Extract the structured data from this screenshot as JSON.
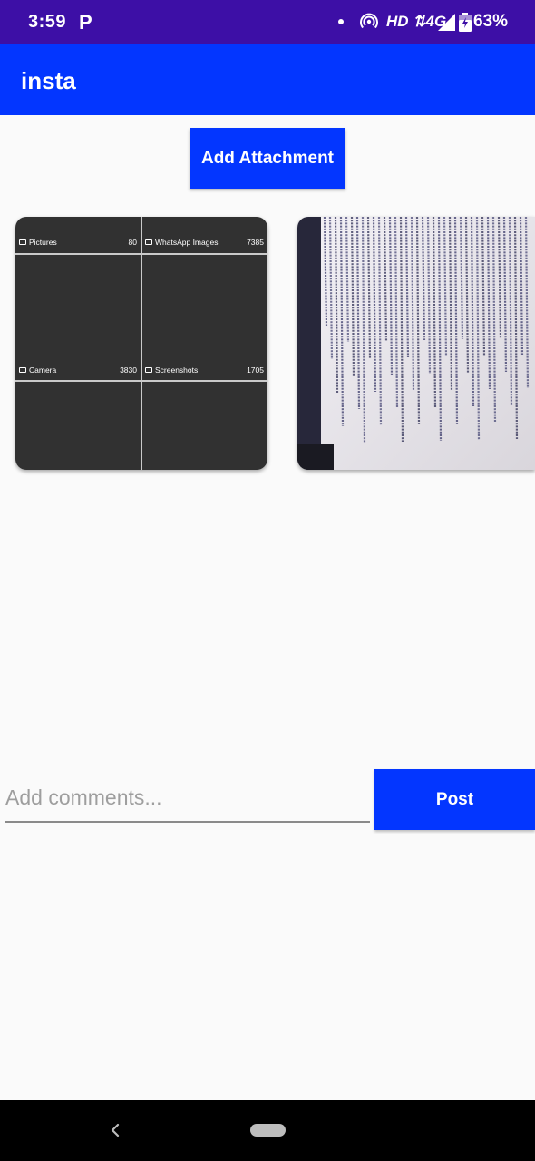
{
  "status_bar": {
    "time": "3:59",
    "notification_icon": "P",
    "network": "HD ⇅4G",
    "battery": "63%",
    "icons": [
      "notification-dot-icon",
      "hotspot-icon",
      "signal-icon",
      "battery-icon"
    ]
  },
  "app_bar": {
    "title": "insta"
  },
  "attach_button": {
    "label": "Add Attachment"
  },
  "gallery": {
    "folders": [
      {
        "name": "Pictures",
        "count": "80"
      },
      {
        "name": "WhatsApp Images",
        "count": "7385"
      },
      {
        "name": "Camera",
        "count": "3830"
      },
      {
        "name": "Screenshots",
        "count": "1705"
      }
    ]
  },
  "comment": {
    "placeholder": "Add comments...",
    "value": ""
  },
  "post_button": {
    "label": "Post"
  },
  "colors": {
    "status_bar": "#3d0fa6",
    "accent": "#0336ff",
    "background": "#fafafa",
    "thumbnail_bg": "#313131"
  }
}
